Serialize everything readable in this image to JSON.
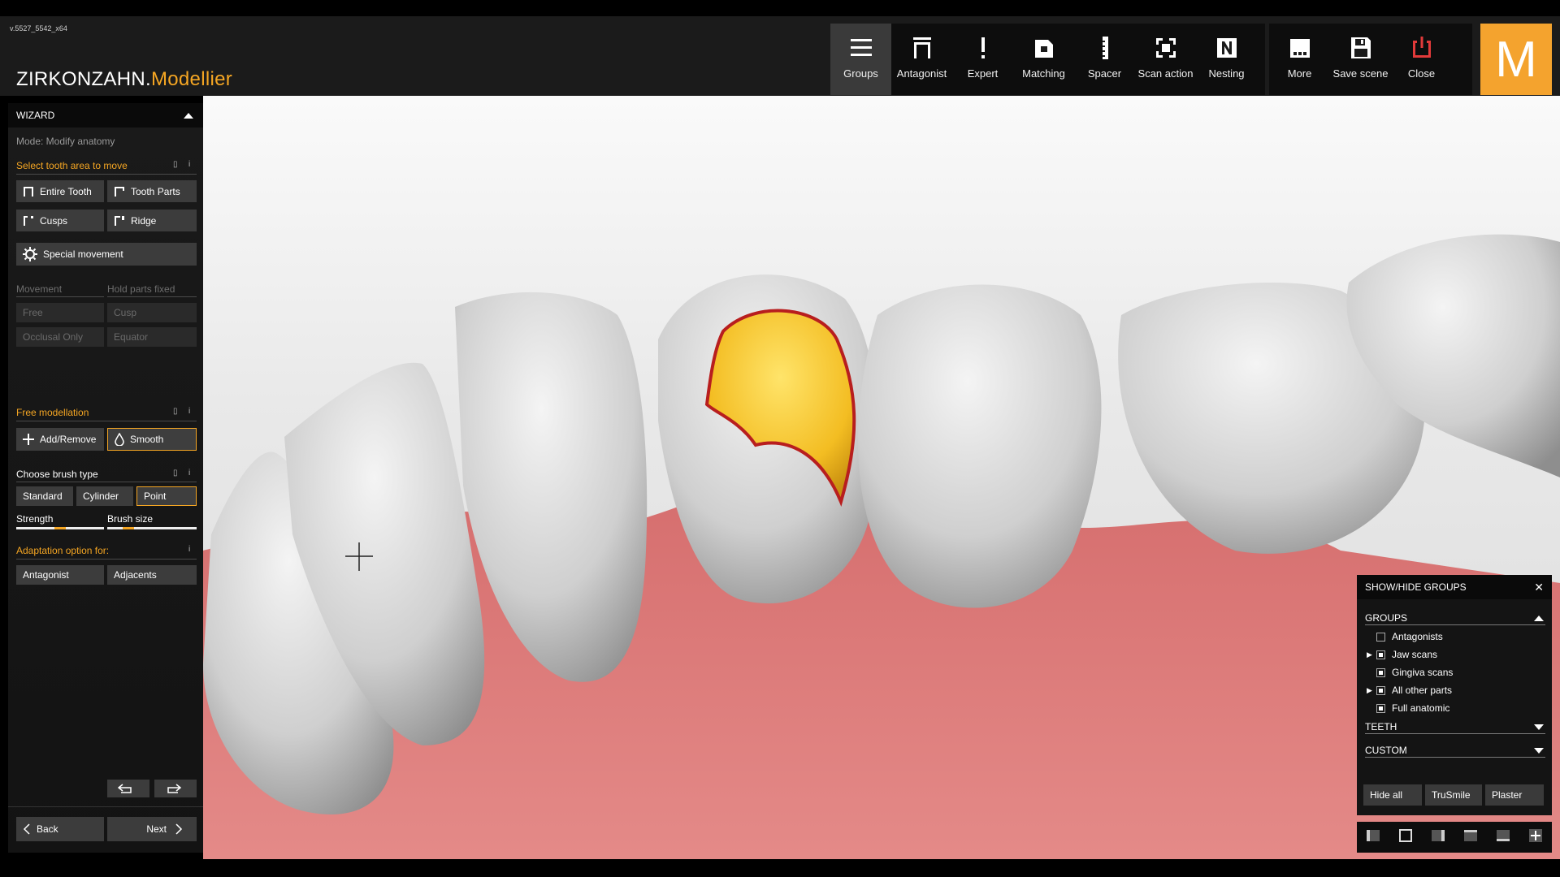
{
  "app": {
    "version": "v.5527_5542_x64",
    "brand_main": "ZIRKONZAHN.",
    "brand_accent": "Modellier",
    "logo_letter": "M",
    "accent_color": "#f5a623"
  },
  "toolbar": {
    "groups": "Groups",
    "antagonist": "Antagonist",
    "expert": "Expert",
    "matching": "Matching",
    "spacer": "Spacer",
    "scan_action": "Scan action",
    "nesting": "Nesting",
    "more": "More",
    "save_scene": "Save scene",
    "close": "Close"
  },
  "wizard": {
    "title": "WIZARD",
    "mode": "Mode: Modify anatomy",
    "select_area": "Select tooth area to move",
    "entire_tooth": "Entire Tooth",
    "tooth_parts": "Tooth Parts",
    "cusps": "Cusps",
    "ridge": "Ridge",
    "special_movement": "Special movement",
    "movement": "Movement",
    "hold_parts_fixed": "Hold parts fixed",
    "free": "Free",
    "cusp": "Cusp",
    "occlusal_only": "Occlusal Only",
    "equator": "Equator",
    "free_modellation": "Free modellation",
    "add_remove": "Add/Remove",
    "smooth": "Smooth",
    "choose_brush": "Choose brush type",
    "standard": "Standard",
    "cylinder": "Cylinder",
    "point": "Point",
    "strength": "Strength",
    "brush_size": "Brush size",
    "strength_value": 0.5,
    "brush_size_value": 0.2,
    "adaptation": "Adaptation option for:",
    "antagonist": "Antagonist",
    "adjacents": "Adjacents",
    "back": "Back",
    "next": "Next"
  },
  "groups_panel": {
    "title": "SHOW/HIDE GROUPS",
    "groups_label": "GROUPS",
    "items": [
      {
        "label": "Antagonists",
        "checked": false,
        "expandable": false
      },
      {
        "label": "Jaw scans",
        "checked": true,
        "expandable": true
      },
      {
        "label": "Gingiva scans",
        "checked": true,
        "expandable": false
      },
      {
        "label": "All other parts",
        "checked": true,
        "expandable": true
      },
      {
        "label": "Full anatomic",
        "checked": true,
        "expandable": false
      }
    ],
    "teeth_label": "TEETH",
    "custom_label": "CUSTOM",
    "hide_all": "Hide all",
    "trusmile": "TruSmile",
    "plaster": "Plaster"
  },
  "colors": {
    "gingiva": "#d97070",
    "tooth": "#d8d8d8",
    "highlight": "#f3bd22"
  }
}
